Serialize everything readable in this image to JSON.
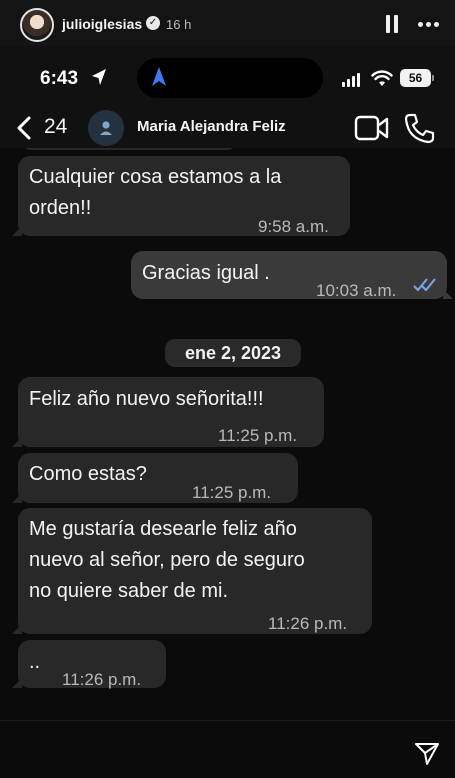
{
  "story": {
    "username": "julioiglesias",
    "verified_icon": "verified-badge-icon",
    "time": "16 h"
  },
  "status_bar": {
    "time": "6:43",
    "battery": "56"
  },
  "chat_header": {
    "back_count": "24",
    "contact_name": "Maria Alejandra Feliz"
  },
  "date_separator": "ene 2, 2023",
  "messages": [
    {
      "direction": "incoming",
      "text": "Cualquier cosa estamos a la\norden!!",
      "time": "9:58 a.m."
    },
    {
      "direction": "outgoing",
      "text": "Gracias igual .",
      "time": "10:03 a.m.",
      "read": true
    },
    {
      "direction": "incoming",
      "text": "Feliz año nuevo señorita!!!",
      "time": "11:25 p.m."
    },
    {
      "direction": "incoming",
      "text": "Como estas?",
      "time": "11:25 p.m."
    },
    {
      "direction": "incoming",
      "text": "Me gustaría desearle feliz año\nnuevo al señor, pero de seguro\nno quiere saber de mi.",
      "time": "11:26 p.m."
    },
    {
      "direction": "incoming",
      "text": "..",
      "time": "11:26 p.m."
    }
  ],
  "colors": {
    "incoming_bubble": "#282828",
    "outgoing_bubble": "#3a3a3a",
    "read_ticks": "#7aa7e6",
    "background": "#0b0b0b"
  }
}
